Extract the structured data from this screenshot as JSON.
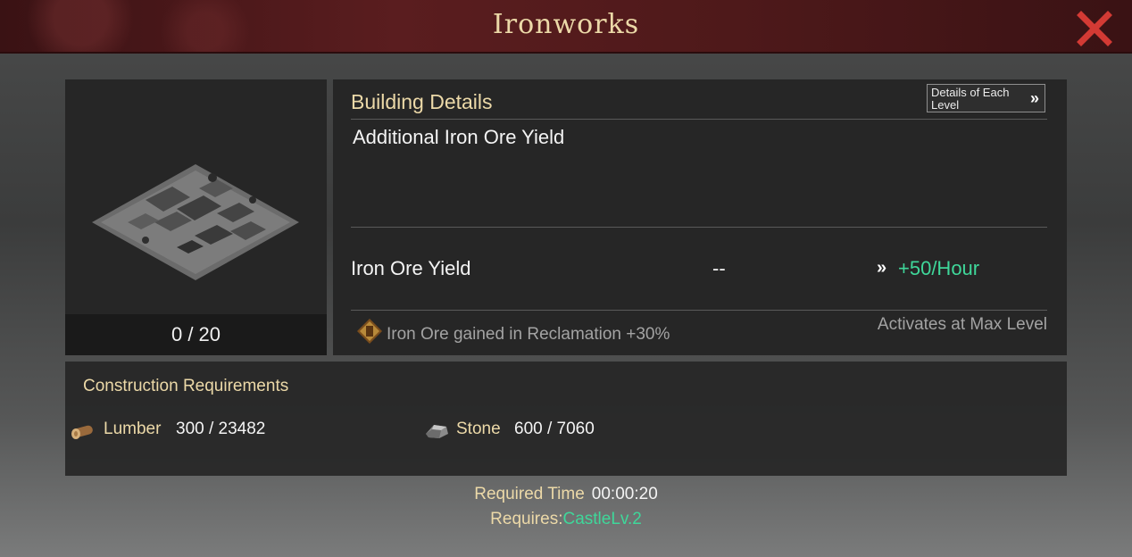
{
  "window": {
    "title": "Ironworks"
  },
  "building": {
    "level_text": "0 / 20"
  },
  "details": {
    "title": "Building Details",
    "levels_button_label": "Details of Each Level",
    "description": "Additional Iron Ore Yield",
    "stat_label": "Iron Ore Yield",
    "stat_current": "--",
    "stat_next": "+50/Hour",
    "bonus_text": "Iron Ore gained in Reclamation +30%",
    "bonus_condition": "Activates at Max Level"
  },
  "requirements": {
    "title": "Construction Requirements",
    "resources": [
      {
        "name": "Lumber",
        "value": "300 / 23482",
        "icon": "lumber-icon"
      },
      {
        "name": "Stone",
        "value": "600 / 7060",
        "icon": "stone-icon"
      }
    ],
    "time_label": "Required Time",
    "time_value": "00:00:20",
    "prereq_label": "Requires:",
    "prereq_value": "CastleLv.2"
  },
  "colors": {
    "accent_gold": "#ecd9a8",
    "positive_green": "#3fd79a",
    "close_red": "#d33a34"
  }
}
